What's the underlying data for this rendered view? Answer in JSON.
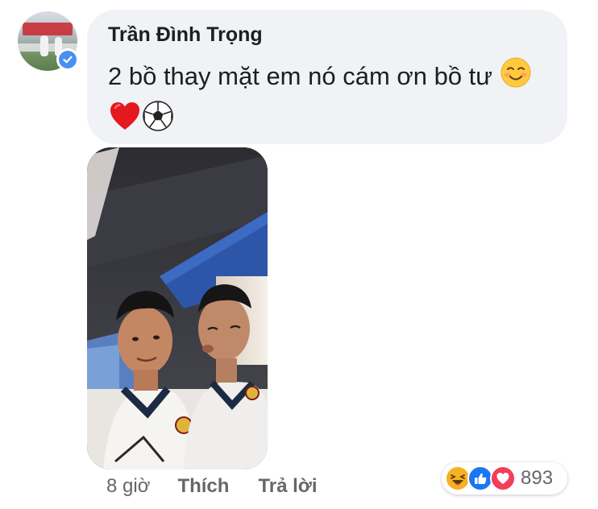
{
  "comment": {
    "author": "Trần Đình Trọng",
    "text": "2 bồ thay mặt em nó cám ơn bồ tư",
    "emojis": [
      "smiling-face-icon",
      "red-heart-icon",
      "soccer-ball-icon"
    ],
    "time": "8 giờ",
    "like_label": "Thích",
    "reply_label": "Trả lời"
  },
  "reactions": {
    "types": [
      "haha-reaction-icon",
      "like-reaction-icon",
      "love-reaction-icon"
    ],
    "count": "893"
  },
  "colors": {
    "bubble": "#f0f2f5",
    "verified": "#4b8ff0",
    "like": "#1877f2",
    "love": "#f33e58",
    "haha": "#f7b125",
    "meta_text": "#65676b"
  }
}
